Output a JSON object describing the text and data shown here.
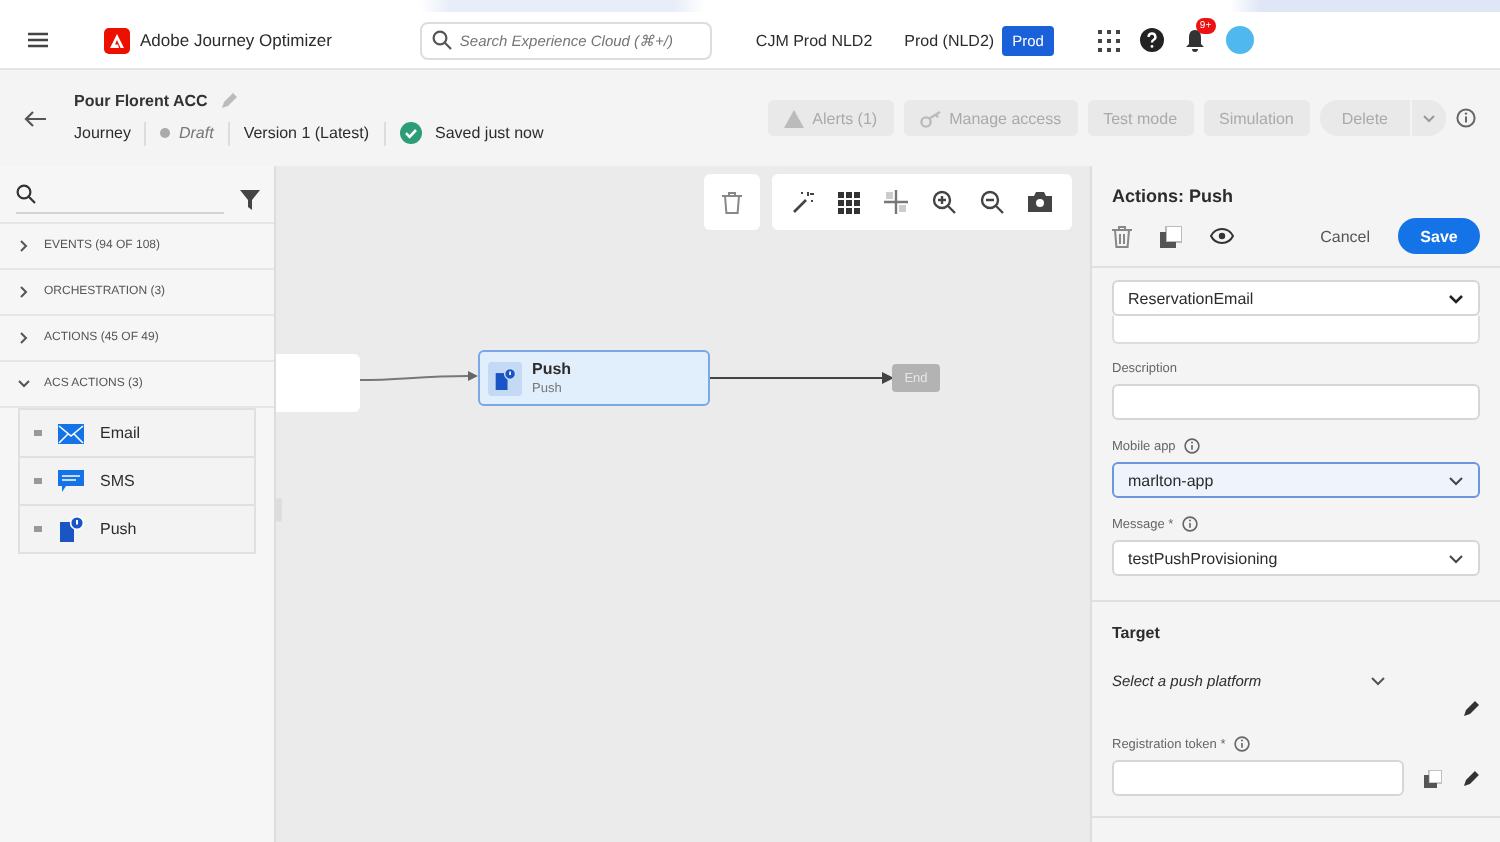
{
  "app": {
    "title": "Adobe Journey Optimizer",
    "search_placeholder": "Search Experience Cloud (⌘+/)",
    "org": "CJM Prod NLD2",
    "sandbox": "Prod (NLD2)",
    "sandbox_badge": "Prod",
    "notifications_badge": "9+"
  },
  "journey": {
    "name": "Pour Florent ACC",
    "type": "Journey",
    "status": "Draft",
    "version": "Version 1 (Latest)",
    "saved": "Saved just now"
  },
  "toolbar": [
    {
      "label": "Alerts (1)",
      "kind": "alert",
      "disabled": true
    },
    {
      "label": "Manage access",
      "kind": "key",
      "disabled": true
    },
    {
      "label": "Test mode",
      "kind": "plain",
      "disabled": true
    },
    {
      "label": "Simulation",
      "kind": "plain",
      "disabled": true
    },
    {
      "label": "Delete",
      "kind": "split",
      "disabled": true
    }
  ],
  "palette": {
    "categories": [
      {
        "label": "EVENTS (94 OF 108)",
        "expanded": false
      },
      {
        "label": "ORCHESTRATION (3)",
        "expanded": false
      },
      {
        "label": "ACTIONS (45 OF 49)",
        "expanded": false
      },
      {
        "label": "ACS ACTIONS (3)",
        "expanded": true,
        "children": [
          {
            "label": "Email",
            "kind": "email"
          },
          {
            "label": "SMS",
            "kind": "sms"
          },
          {
            "label": "Push",
            "kind": "push"
          }
        ]
      }
    ]
  },
  "canvas": {
    "node": {
      "title": "Push",
      "subtitle": "Push",
      "selected": true
    },
    "end_label": "End"
  },
  "panel": {
    "title": "Actions: Push",
    "cancel": "Cancel",
    "save": "Save",
    "action_value": "ReservationEmail",
    "description_label": "Description",
    "mobile_app": {
      "label": "Mobile app",
      "value": "marlton-app",
      "focused": true
    },
    "message": {
      "label": "Message *",
      "value": "testPushProvisioning",
      "focused": false
    },
    "target": {
      "heading": "Target",
      "platform_placeholder": "Select a push platform",
      "token_label": "Registration token *"
    }
  }
}
